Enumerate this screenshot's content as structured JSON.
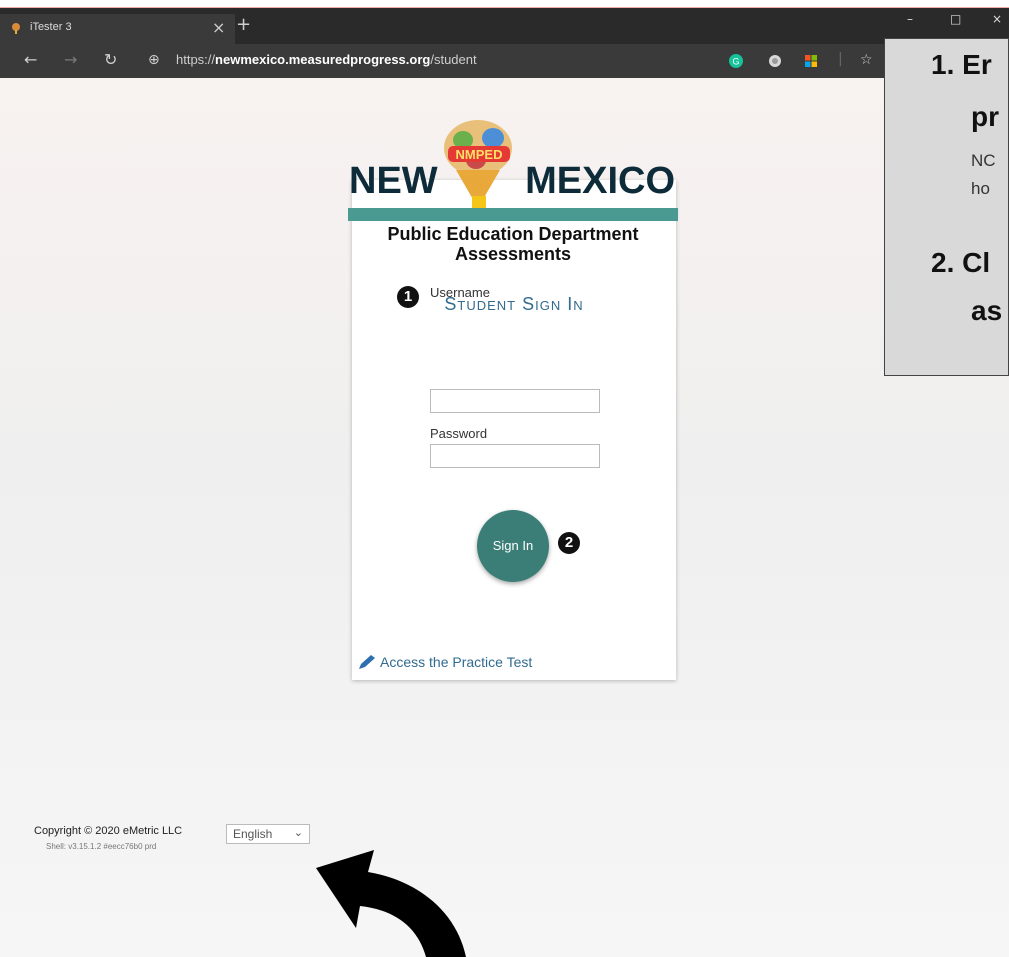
{
  "browser": {
    "tab_title": "iTester 3",
    "tab_close": "×",
    "new_tab": "+",
    "window_controls": [
      "–",
      "□",
      "×"
    ],
    "url_scheme": "https://",
    "url_host": "newmexico.measuredprogress.org",
    "url_path": "/student",
    "nav_icons": [
      "back-icon",
      "forward-icon",
      "refresh-icon",
      "globe-icon"
    ],
    "extensions": [
      "grammarly-icon",
      "record-icon",
      "windows-icon",
      "favorites-icon"
    ]
  },
  "logo": {
    "badge": "NMPED",
    "word_left": "NEW",
    "word_right": "MEXICO",
    "line1": "Public Education Department",
    "line2": "Assessments"
  },
  "login": {
    "title": "Student Sign In",
    "username_label": "Username",
    "password_label": "Password",
    "sign_in": "Sign In",
    "practice_link": "Access the Practice Test",
    "step1": "1",
    "step2": "2"
  },
  "callout": {
    "item1_num": "1.",
    "item1_a": "Er",
    "item1_b": "pr",
    "item1_c": "NC",
    "item1_d": "ho",
    "item2_num": "2.",
    "item2_a": "Cl",
    "item2_b": "as"
  },
  "footer": {
    "copyright": "Copyright © 2020 eMetric LLC",
    "version": "Shell: v3.15.1.2  #eecc76b0  prd",
    "language": "English"
  },
  "colors": {
    "teal": "#4a9a91",
    "button": "#3b7e77",
    "link": "#316b8f",
    "browser_dark": "#2a2a2a"
  }
}
